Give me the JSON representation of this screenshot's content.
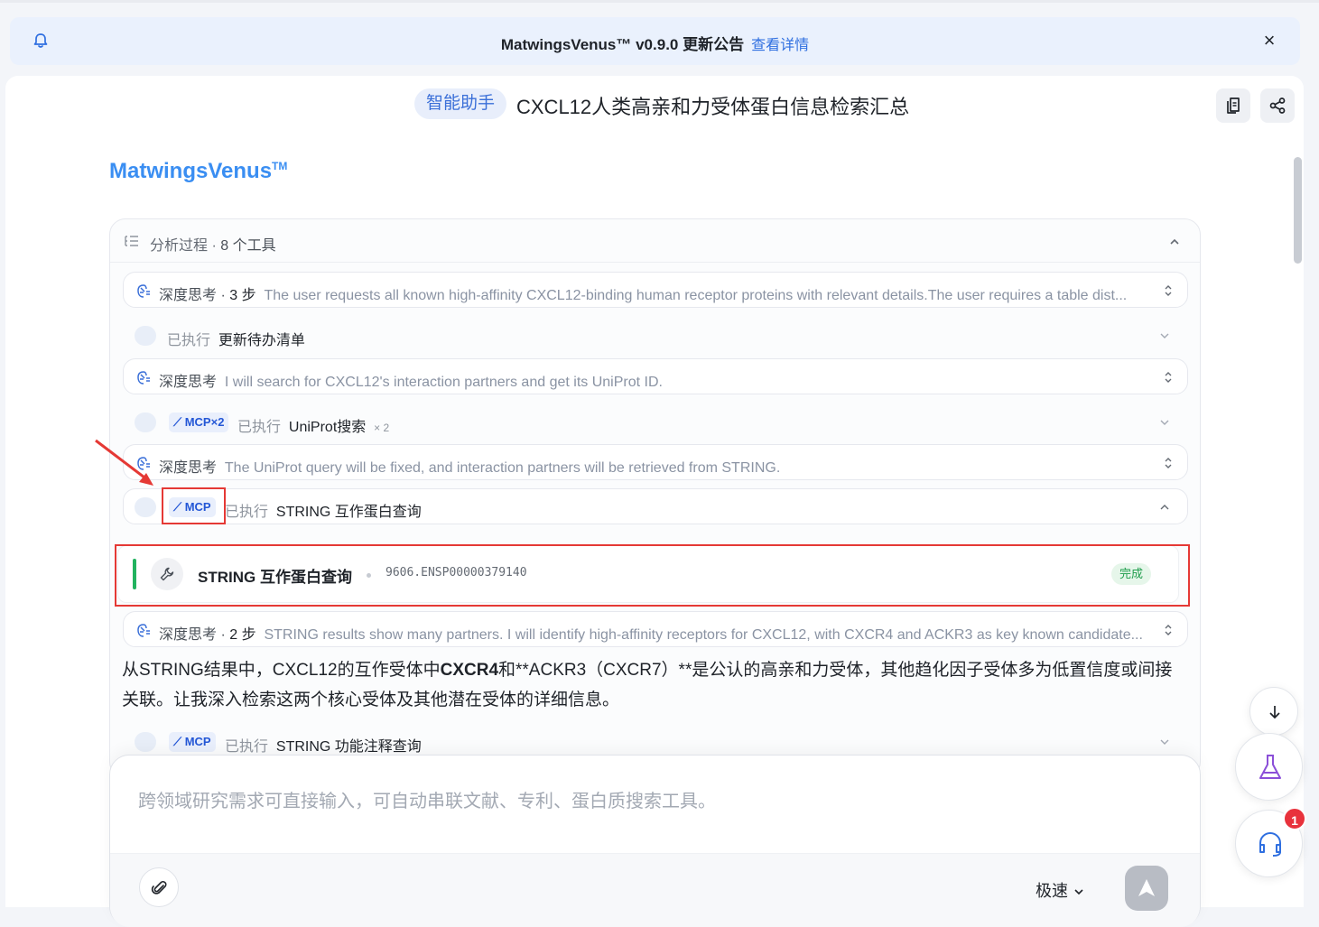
{
  "notice": {
    "title": "MatwingsVenus™ v0.9.0 更新公告",
    "link": "查看详情",
    "close": "×"
  },
  "header": {
    "badge": "智能助手",
    "title": "CXCL12人类高亲和力受体蛋白信息检索汇总"
  },
  "brand": {
    "name": "MatwingsVenus",
    "tm": "TM"
  },
  "analysis": {
    "label": "分析过程",
    "tool_count": "8 个工具",
    "rows": [
      {
        "kind": "think",
        "label": "深度思考",
        "steps": "3 步",
        "text": "The user requests all known high-affinity CXCL12-binding human receptor proteins with relevant details.The user requires a table dist..."
      },
      {
        "kind": "exec",
        "status": "已执行",
        "name": "更新待办清单"
      },
      {
        "kind": "think",
        "label": "深度思考",
        "text": "I will search for CXCL12's interaction partners and get its UniProt ID."
      },
      {
        "kind": "exec",
        "mcp": "MCP×2",
        "status": "已执行",
        "name": "UniProt搜索",
        "mult": "× 2"
      },
      {
        "kind": "think",
        "label": "深度思考",
        "text": "The UniProt query will be fixed, and interaction partners will be retrieved from STRING."
      },
      {
        "kind": "exec",
        "mcp": "MCP",
        "status": "已执行",
        "name": "STRING 互作蛋白查询"
      },
      {
        "kind": "think",
        "label": "深度思考",
        "steps": "2 步",
        "text": "STRING results show many partners. I will identify high-affinity receptors for CXCL12, with CXCR4 and ACKR3 as key known candidate..."
      },
      {
        "kind": "exec",
        "mcp": "MCP",
        "status": "已执行",
        "name": "STRING 功能注释查询"
      }
    ],
    "tool_card": {
      "title": "STRING 互作蛋白查询",
      "id": "9606.ENSP00000379140",
      "status": "完成"
    },
    "paragraph": {
      "p1": "从STRING结果中，CXCL12的互作受体中",
      "b1": "CXCR4",
      "p2": "和**ACKR3（CXCR7）**是公认的高亲和力受体，其他趋化因子受体多为低置信度或间接关联。让我深入检索这两个核心受体及其他潜在受体的详细信息。"
    }
  },
  "composer": {
    "placeholder": "跨领域研究需求可直接输入，可自动串联文献、专利、蛋白质搜索工具。",
    "speed": "极速"
  },
  "support_badge": "1",
  "colors": {
    "accent": "#3a8ef2",
    "link": "#2f6fe0",
    "annotation": "#e53935",
    "done": "#1f9d4c"
  }
}
